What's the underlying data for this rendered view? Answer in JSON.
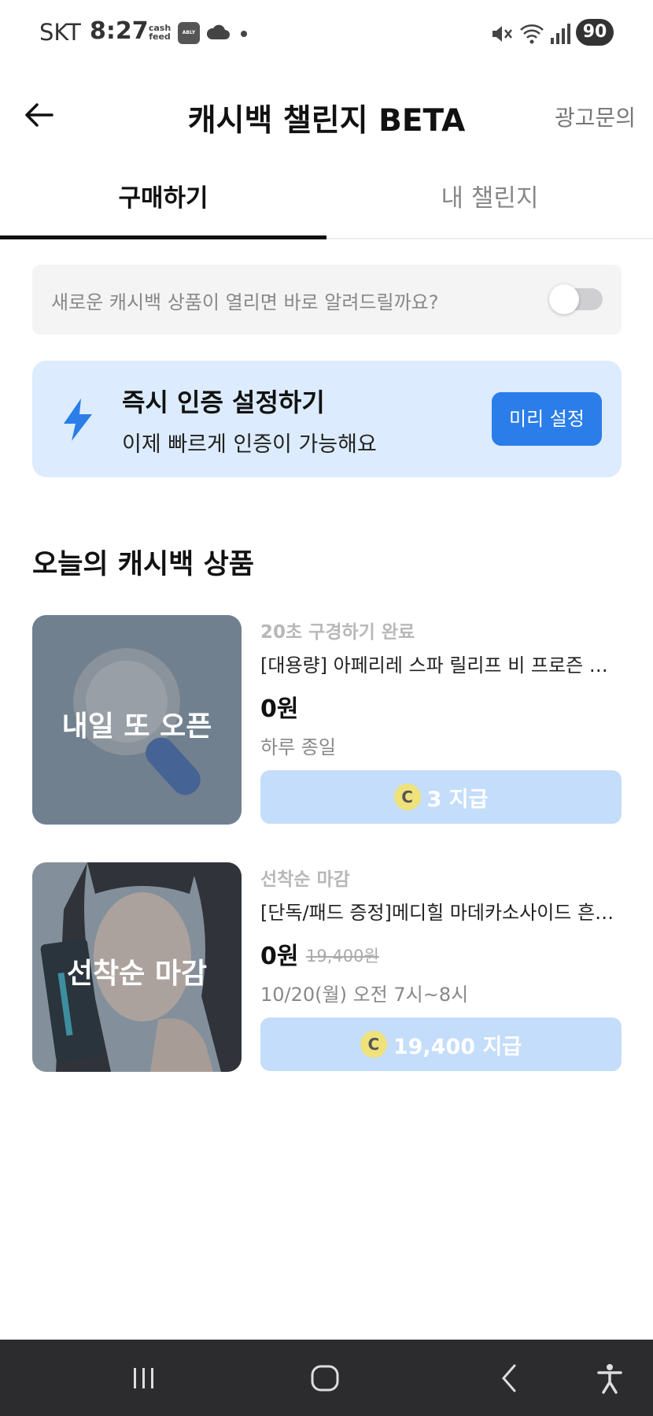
{
  "status_bar": {
    "carrier": "SKT",
    "time": "8:27",
    "cashfeed_icon": "cash feed",
    "ably_icon": "ABLY",
    "battery": "90",
    "icons": [
      "cloud-icon",
      "mute-icon",
      "wifi-icon",
      "signal-icon"
    ]
  },
  "header": {
    "title": "캐시백 챌린지 BETA",
    "ad_inquiry": "광고문의"
  },
  "tabs": [
    {
      "label": "구매하기",
      "active": true
    },
    {
      "label": "내 챌린지",
      "active": false
    }
  ],
  "notify": {
    "text": "새로운 캐시백 상품이 열리면 바로 알려드릴까요?",
    "toggle_on": false
  },
  "auth_card": {
    "title": "즉시 인증 설정하기",
    "subtitle": "이제 빠르게 인증이 가능해요",
    "button": "미리 설정"
  },
  "section": {
    "title": "오늘의 캐시백 상품"
  },
  "products": [
    {
      "thumb_label": "내일 또 오픈",
      "condition": "20초 구경하기 완료",
      "name": "[대용량] 아페리레 스파 릴리프 비 프로즌 빙하…",
      "price": "0원",
      "original_price": "",
      "schedule": "하루 종일",
      "coin": "C",
      "reward": "3 지급"
    },
    {
      "thumb_label": "선착순 마감",
      "condition": "선착순 마감",
      "name": "[단독/패드 증정]메디힐 마데카소사이드 흔적 …",
      "price": "0원",
      "original_price": "19,400원",
      "schedule": "10/20(월) 오전 7시~8시",
      "coin": "C",
      "reward": "19,400 지급"
    }
  ],
  "colors": {
    "accent": "#2b7de9",
    "card_bg": "#dcebfd",
    "reward_bg": "#c4ddfa",
    "coin": "#efe27a",
    "navbar": "#2c2c2e"
  }
}
